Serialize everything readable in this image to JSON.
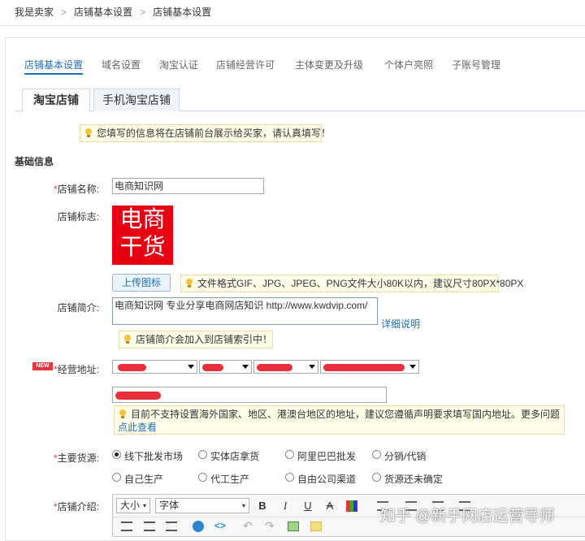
{
  "breadcrumb": [
    "我是卖家",
    "店铺基本设置",
    "店铺基本设置"
  ],
  "breadcrumb_sep": ">",
  "tabs": [
    "店铺基本设置",
    "域名设置",
    "淘宝认证",
    "店铺经营许可",
    "主体变更及升级",
    "个体户亮照",
    "子账号管理"
  ],
  "sub_tabs": [
    "淘宝店铺",
    "手机淘宝店铺"
  ],
  "notice_top": "您填写的信息将在店铺前台展示给买家，请认真填写！",
  "section_basic": "基础信息",
  "form": {
    "name_label": "店铺名称:",
    "name_value": "电商知识网",
    "logo_label": "店铺标志:",
    "logo_text_line1": "电商",
    "logo_text_line2": "干货",
    "upload_button": "上传图标",
    "upload_hint": "文件格式GIF、JPG、JPEG、PNG文件大小80K以内，建议尺寸80PX*80PX",
    "intro_label": "店铺简介:",
    "intro_value": "电商知识网 专业分享电商网店知识 http://www.kwdvip.com/",
    "detail_link": "详细说明",
    "intro_hint": "店铺简介会加入到店铺索引中！",
    "new_badge": "NEW",
    "address_label": "经营地址:",
    "address_hint": "目前不支持设置海外国家、地区、港澳台地区的地址，建议您遵循声明要求填写国内地址。",
    "address_more": "更多问题",
    "address_link": "点此查看",
    "source_label": "主要货源:",
    "sources": [
      "线下批发市场",
      "实体店拿货",
      "阿里巴巴批发",
      "分销/代销",
      "自己生产",
      "代工生产",
      "自由公司渠道",
      "货源还未确定"
    ],
    "intro2_label": "店铺介绍:",
    "required_mark": "*"
  },
  "editor": {
    "size_label": "大小",
    "font_label": "字体",
    "bold": "B",
    "italic": "I",
    "underline": "U",
    "strike": "A"
  },
  "watermark": "知乎 @新手网店运营导师"
}
